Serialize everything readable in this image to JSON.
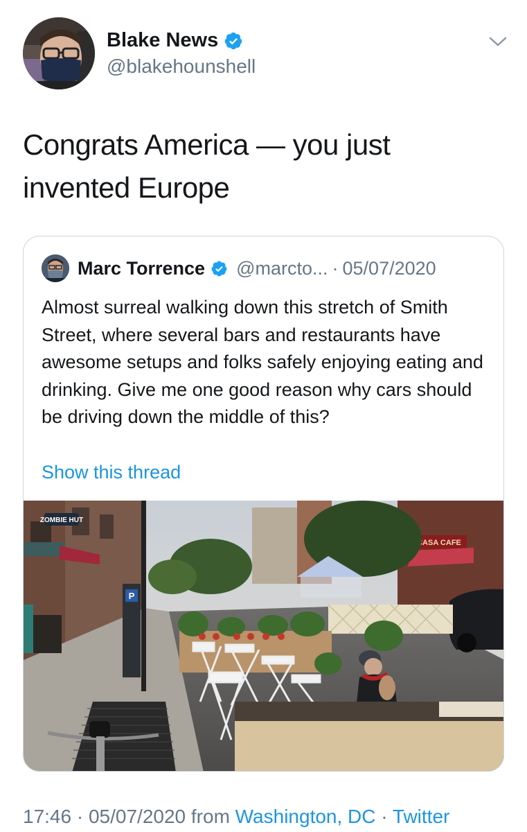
{
  "author": {
    "name": "Blake News",
    "handle": "@blakehounshell",
    "verified": true
  },
  "tweet": {
    "text": "Congrats America — you just invented Europe"
  },
  "quoted": {
    "name": "Marc Torrence",
    "handle": "@marcto...",
    "separator": "·",
    "date": "05/07/2020",
    "verified": true,
    "text": "Almost surreal walking down this stretch of Smith Street, where several bars and restaurants have awesome setups and folks safely enjoying eating and drinking. Give me one good reason why cars should be driving down the middle of this?",
    "show_thread": "Show this thread",
    "photo_signs": {
      "zombie": "ZOMBIE HUT",
      "cafe": "CASA CAFE",
      "parking": "P"
    }
  },
  "footer": {
    "time": "17:46",
    "sep1": "·",
    "date": "05/07/2020",
    "from": "from",
    "location": "Washington, DC",
    "sep2": "·",
    "source": "Twitter"
  },
  "colors": {
    "accent": "#1b95e0",
    "verified": "#1da1f2",
    "secondary_text": "#657786",
    "border": "#ccd6dd"
  },
  "icons": [
    "verified-badge-icon",
    "chevron-down-icon"
  ]
}
